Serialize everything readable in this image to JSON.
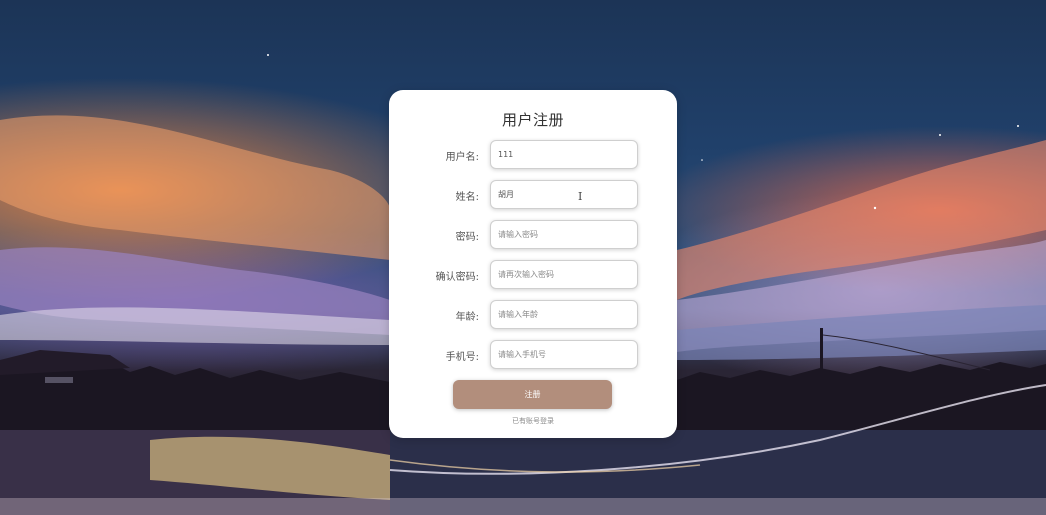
{
  "form": {
    "title": "用户注册",
    "fields": [
      {
        "label": "用户名:",
        "value": "111",
        "placeholder": ""
      },
      {
        "label": "姓名:",
        "value": "胡月",
        "placeholder": ""
      },
      {
        "label": "密码:",
        "value": "",
        "placeholder": "请输入密码"
      },
      {
        "label": "确认密码:",
        "value": "",
        "placeholder": "请再次输入密码"
      },
      {
        "label": "年龄:",
        "value": "",
        "placeholder": "请输入年龄"
      },
      {
        "label": "手机号:",
        "value": "",
        "placeholder": "请输入手机号"
      }
    ],
    "submit_label": "注册",
    "login_link": "已有账号登录",
    "cursor_icon": "text-cursor-icon"
  },
  "colors": {
    "card": "#ffffff",
    "button": "#b28e7c",
    "sky_top": "#1c3456",
    "sunset": "#ff8c3c"
  }
}
